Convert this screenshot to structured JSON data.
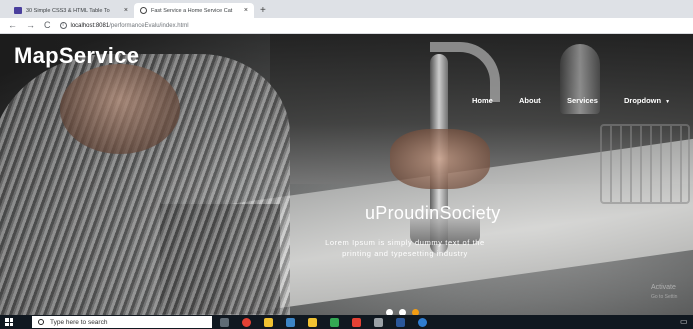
{
  "browser": {
    "tabs": [
      {
        "label": "30 Simple CSS3 & HTML Table To",
        "close": "×",
        "active": false
      },
      {
        "label": "Fast Service a Home Service Cat",
        "close": "×",
        "active": true
      }
    ],
    "new_tab": "+",
    "nav": {
      "back": "←",
      "forward": "→",
      "reload": "C"
    },
    "url_host": "localhost:8081",
    "url_path": "/performanceEvalu/index.html"
  },
  "site": {
    "brand": "MapService",
    "nav": [
      {
        "label": "Home"
      },
      {
        "label": "About"
      },
      {
        "label": "Services"
      },
      {
        "label": "Dropdown",
        "caret": "▼"
      }
    ],
    "slide_title": "uProudinSociety",
    "slide_desc_line1": "Lorem Ipsum is simply dummy text of the",
    "slide_desc_line2": "printing and typesetting industry",
    "carousel": {
      "count": 3,
      "active_index": 2,
      "active_color": "#f39c12",
      "dot_color": "#ffffff"
    }
  },
  "windows": {
    "watermark": "Activate",
    "watermark_sub": "Go to Settin",
    "search_placeholder": "Type here to search",
    "taskbar_icons": [
      "task-view-icon",
      "chrome-icon",
      "file-explorer-icon",
      "mail-icon",
      "store-icon",
      "app-icon",
      "media-icon",
      "settings-icon",
      "word-icon",
      "edge-icon"
    ]
  },
  "colors": {
    "accent": "#f39c12",
    "taskbar": "#101820",
    "tabstrip": "#dee1e6"
  }
}
